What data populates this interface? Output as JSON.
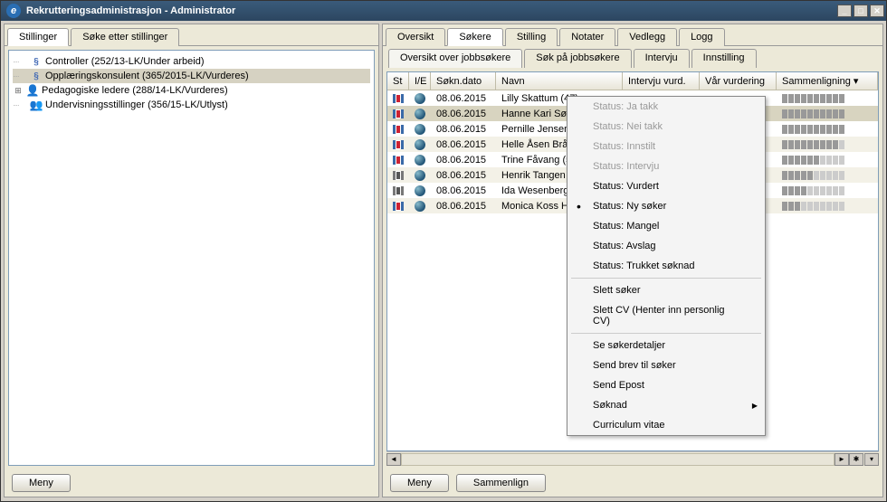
{
  "window": {
    "title": "Rekrutteringsadministrasjon - Administrator"
  },
  "left_tabs": [
    {
      "label": "Stillinger",
      "active": true
    },
    {
      "label": "Søke etter stillinger",
      "active": false
    }
  ],
  "tree": [
    {
      "label": "Controller (252/13-LK/Under arbeid)",
      "icon": "s",
      "indent": 1
    },
    {
      "label": "Opplæringskonsulent (365/2015-LK/Vurderes)",
      "icon": "s",
      "indent": 1,
      "selected": true
    },
    {
      "label": "Pedagogiske ledere (288/14-LK/Vurderes)",
      "icon": "person",
      "indent": 1,
      "toggle": "+"
    },
    {
      "label": "Undervisningsstillinger (356/15-LK/Utlyst)",
      "icon": "group",
      "indent": 1
    }
  ],
  "right_tabs": [
    {
      "label": "Oversikt",
      "active": false
    },
    {
      "label": "Søkere",
      "active": true
    },
    {
      "label": "Stilling",
      "active": false
    },
    {
      "label": "Notater",
      "active": false
    },
    {
      "label": "Vedlegg",
      "active": false
    },
    {
      "label": "Logg",
      "active": false
    }
  ],
  "sub_tabs": [
    {
      "label": "Oversikt over jobbsøkere",
      "active": true
    },
    {
      "label": "Søk på jobbsøkere",
      "active": false
    },
    {
      "label": "Intervju",
      "active": false
    },
    {
      "label": "Innstilling",
      "active": false
    }
  ],
  "columns": {
    "st": "St",
    "ie": "I/E",
    "date": "Søkn.dato",
    "name": "Navn",
    "iv": "Intervju vurd.",
    "vv": "Vår vurdering",
    "sam": "Sammenligning"
  },
  "rows": [
    {
      "date": "08.06.2015",
      "name": "Lilly Skattum (47)",
      "bars": 10,
      "flag_gray": false
    },
    {
      "date": "08.06.2015",
      "name": "Hanne Kari Søsveen (41)",
      "bars": 10,
      "selected": true,
      "flag_gray": false
    },
    {
      "date": "08.06.2015",
      "name": "Pernille Jensen (39)",
      "bars": 10,
      "flag_gray": false
    },
    {
      "date": "08.06.2015",
      "name": "Helle Åsen Bråstad",
      "bars": 9,
      "flag_gray": false
    },
    {
      "date": "08.06.2015",
      "name": "Trine Fåvang (55)",
      "bars": 6,
      "flag_gray": false
    },
    {
      "date": "08.06.2015",
      "name": "Henrik Tangen Helset",
      "bars": 5,
      "flag_gray": true
    },
    {
      "date": "08.06.2015",
      "name": "Ida Wesenberg Fj",
      "bars": 4,
      "flag_gray": true
    },
    {
      "date": "08.06.2015",
      "name": "Monica Koss Hellan",
      "bars": 3,
      "flag_gray": false
    }
  ],
  "context_menu": [
    {
      "label": "Status: Ja takk",
      "disabled": true
    },
    {
      "label": "Status: Nei takk",
      "disabled": true
    },
    {
      "label": "Status: Innstilt",
      "disabled": true
    },
    {
      "label": "Status: Intervju",
      "disabled": true
    },
    {
      "label": "Status: Vurdert"
    },
    {
      "label": "Status: Ny søker",
      "dot": true
    },
    {
      "label": "Status: Mangel"
    },
    {
      "label": "Status: Avslag"
    },
    {
      "label": "Status: Trukket søknad"
    },
    {
      "sep": true
    },
    {
      "label": "Slett søker"
    },
    {
      "label": "Slett CV (Henter inn personlig CV)"
    },
    {
      "sep": true
    },
    {
      "label": "Se søkerdetaljer"
    },
    {
      "label": "Send brev til søker"
    },
    {
      "label": "Send Epost"
    },
    {
      "label": "Søknad",
      "submenu": true
    },
    {
      "label": "Curriculum vitae"
    }
  ],
  "buttons": {
    "meny": "Meny",
    "sammenlign": "Sammenlign"
  }
}
